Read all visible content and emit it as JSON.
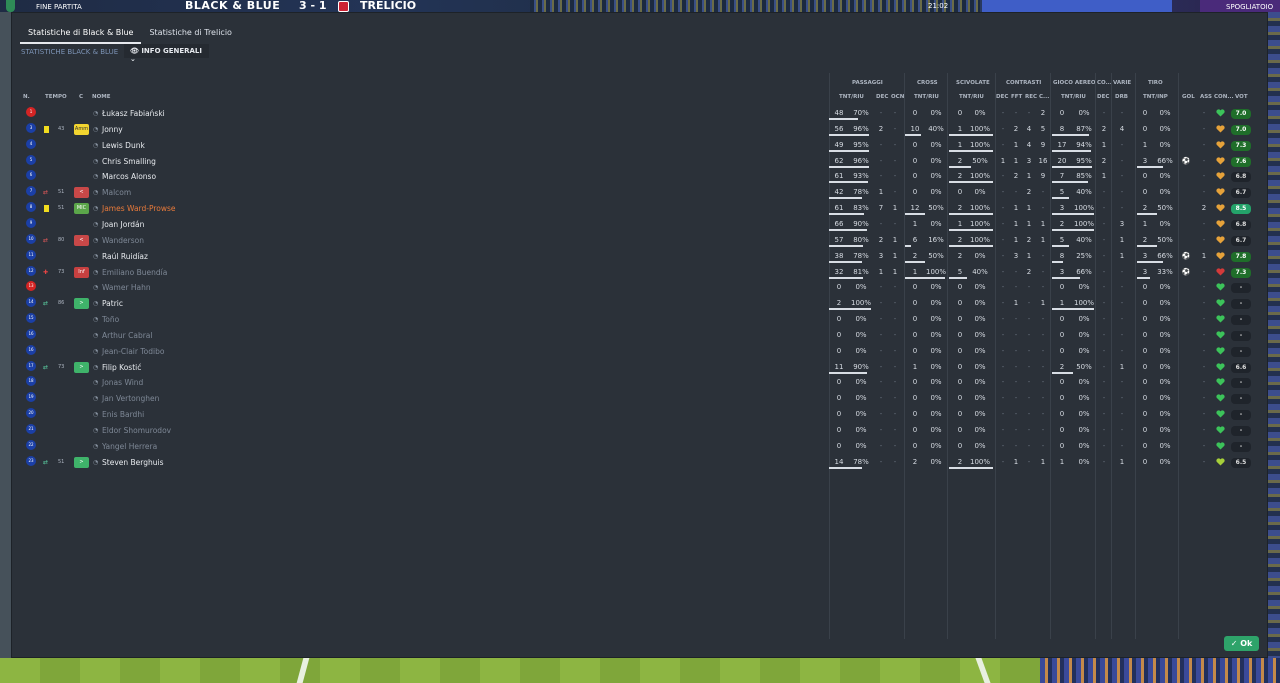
{
  "topbar": {
    "status": "FINE PARTITA",
    "home": "BLACK & BLUE",
    "score": "3 - 1",
    "away": "TRELICIO",
    "time": "21:02",
    "speaker": "SPOGLIATOIO"
  },
  "tabs": [
    {
      "label": "Statistiche di Black & Blue",
      "active": true
    },
    {
      "label": "Statistiche di Trelicio",
      "active": false
    }
  ],
  "subtitle": "STATISTICHE BLACK & BLUE",
  "dropdown": "INFO GENERALI",
  "groups": {
    "passaggi": "PASSAGGI",
    "cross": "CROSS",
    "scivolate": "SCIVOLATE",
    "contrasti": "CONTRASTI",
    "gioco_aereo": "GIOCO AEREO",
    "co": "CO...",
    "varie": "VARIE",
    "tiro": "TIRO"
  },
  "columns": {
    "n": "N.",
    "tempo": "TEMPO",
    "c": "C",
    "nome": "NOME",
    "pass_tnt": "TNT/RIU",
    "pass_dec": "DEC",
    "pass_ocn": "OCN",
    "cross_tnt": "TNT/RIU",
    "sciv_tnt": "TNT/RIU",
    "con_dec": "DEC",
    "con_fft": "FFT",
    "con_rec": "REC",
    "con_c": "C...",
    "aereo_tnt": "TNT/RIU",
    "co_dec": "DEC",
    "varie_drb": "DRB",
    "tiro_tnt": "TNT/INP",
    "gol": "GOL",
    "ass": "ASS",
    "con": "CON...",
    "vot": "VOT"
  },
  "players": [
    {
      "num": "1",
      "gk": true,
      "yellow": false,
      "ev": "",
      "min": "",
      "badge": "",
      "badge_text": "",
      "name": "Łukasz Fabiański",
      "dim": false,
      "or": false,
      "p_t": "48",
      "p_p": "70%",
      "p_dec": "-",
      "p_ocn": "-",
      "c_t": "0",
      "c_p": "0%",
      "s_t": "0",
      "s_p": "0%",
      "k_dec": "-",
      "k_fft": "-",
      "k_rec": "-",
      "k_c": "2",
      "a_t": "0",
      "a_p": "0%",
      "co": "-",
      "drb": "-",
      "t_t": "0",
      "t_p": "0%",
      "gol": "",
      "ass": "-",
      "heart": "green",
      "vot": "7.0",
      "vc": "r-green"
    },
    {
      "num": "3",
      "gk": false,
      "yellow": true,
      "ev": "",
      "min": "43",
      "badge": "b-amm",
      "badge_text": "Amm",
      "name": "Jonny",
      "dim": false,
      "or": false,
      "p_t": "56",
      "p_p": "96%",
      "p_dec": "2",
      "p_ocn": "-",
      "c_t": "10",
      "c_p": "40%",
      "s_t": "1",
      "s_p": "100%",
      "k_dec": "-",
      "k_fft": "2",
      "k_rec": "4",
      "k_c": "5",
      "a_t": "8",
      "a_p": "87%",
      "co": "2",
      "drb": "4",
      "t_t": "0",
      "t_p": "0%",
      "gol": "",
      "ass": "-",
      "heart": "orange",
      "vot": "7.0",
      "vc": "r-green"
    },
    {
      "num": "4",
      "gk": false,
      "yellow": false,
      "ev": "",
      "min": "",
      "badge": "",
      "badge_text": "",
      "name": "Lewis Dunk",
      "dim": false,
      "or": false,
      "p_t": "49",
      "p_p": "95%",
      "p_dec": "-",
      "p_ocn": "-",
      "c_t": "0",
      "c_p": "0%",
      "s_t": "1",
      "s_p": "100%",
      "k_dec": "-",
      "k_fft": "1",
      "k_rec": "4",
      "k_c": "9",
      "a_t": "17",
      "a_p": "94%",
      "co": "1",
      "drb": "-",
      "t_t": "1",
      "t_p": "0%",
      "gol": "",
      "ass": "-",
      "heart": "orange",
      "vot": "7.3",
      "vc": "r-green"
    },
    {
      "num": "5",
      "gk": false,
      "yellow": false,
      "ev": "",
      "min": "",
      "badge": "",
      "badge_text": "",
      "name": "Chris Smalling",
      "dim": false,
      "or": false,
      "p_t": "62",
      "p_p": "96%",
      "p_dec": "-",
      "p_ocn": "-",
      "c_t": "0",
      "c_p": "0%",
      "s_t": "2",
      "s_p": "50%",
      "k_dec": "1",
      "k_fft": "1",
      "k_rec": "3",
      "k_c": "16",
      "a_t": "20",
      "a_p": "95%",
      "co": "2",
      "drb": "-",
      "t_t": "3",
      "t_p": "66%",
      "gol": "⚽",
      "ass": "-",
      "heart": "orange",
      "vot": "7.6",
      "vc": "r-green"
    },
    {
      "num": "6",
      "gk": false,
      "yellow": false,
      "ev": "",
      "min": "",
      "badge": "",
      "badge_text": "",
      "name": "Marcos Alonso",
      "dim": false,
      "or": false,
      "p_t": "61",
      "p_p": "93%",
      "p_dec": "-",
      "p_ocn": "-",
      "c_t": "0",
      "c_p": "0%",
      "s_t": "2",
      "s_p": "100%",
      "k_dec": "-",
      "k_fft": "2",
      "k_rec": "1",
      "k_c": "9",
      "a_t": "7",
      "a_p": "85%",
      "co": "1",
      "drb": "-",
      "t_t": "0",
      "t_p": "0%",
      "gol": "",
      "ass": "-",
      "heart": "orange",
      "vot": "6.8",
      "vc": ""
    },
    {
      "num": "7",
      "gk": false,
      "yellow": false,
      "ev": "sub",
      "min": "51",
      "badge": "b-sub-out",
      "badge_text": "<",
      "name": "Malcom",
      "dim": true,
      "or": false,
      "p_t": "42",
      "p_p": "78%",
      "p_dec": "1",
      "p_ocn": "-",
      "c_t": "0",
      "c_p": "0%",
      "s_t": "0",
      "s_p": "0%",
      "k_dec": "-",
      "k_fft": "-",
      "k_rec": "2",
      "k_c": "-",
      "a_t": "5",
      "a_p": "40%",
      "co": "-",
      "drb": "-",
      "t_t": "0",
      "t_p": "0%",
      "gol": "",
      "ass": "-",
      "heart": "orange",
      "vot": "6.7",
      "vc": ""
    },
    {
      "num": "8",
      "gk": false,
      "yellow": true,
      "ev": "",
      "min": "51",
      "badge": "b-mic",
      "badge_text": "MIC",
      "name": "James Ward-Prowse",
      "dim": false,
      "or": true,
      "p_t": "61",
      "p_p": "83%",
      "p_dec": "7",
      "p_ocn": "1",
      "c_t": "12",
      "c_p": "50%",
      "s_t": "2",
      "s_p": "100%",
      "k_dec": "-",
      "k_fft": "1",
      "k_rec": "1",
      "k_c": "-",
      "a_t": "3",
      "a_p": "100%",
      "co": "-",
      "drb": "-",
      "t_t": "2",
      "t_p": "50%",
      "gol": "",
      "ass": "2",
      "heart": "orange",
      "vot": "8.5",
      "vc": "r-teal"
    },
    {
      "num": "9",
      "gk": false,
      "yellow": false,
      "ev": "",
      "min": "",
      "badge": "",
      "badge_text": "",
      "name": "Joan Jordán",
      "dim": false,
      "or": false,
      "p_t": "66",
      "p_p": "90%",
      "p_dec": "-",
      "p_ocn": "-",
      "c_t": "1",
      "c_p": "0%",
      "s_t": "1",
      "s_p": "100%",
      "k_dec": "-",
      "k_fft": "1",
      "k_rec": "1",
      "k_c": "1",
      "a_t": "2",
      "a_p": "100%",
      "co": "-",
      "drb": "3",
      "t_t": "1",
      "t_p": "0%",
      "gol": "",
      "ass": "-",
      "heart": "orange",
      "vot": "6.8",
      "vc": ""
    },
    {
      "num": "10",
      "gk": false,
      "yellow": false,
      "ev": "sub",
      "min": "80",
      "badge": "b-sub-out",
      "badge_text": "<",
      "name": "Wanderson",
      "dim": true,
      "or": false,
      "p_t": "57",
      "p_p": "80%",
      "p_dec": "2",
      "p_ocn": "1",
      "c_t": "6",
      "c_p": "16%",
      "s_t": "2",
      "s_p": "100%",
      "k_dec": "-",
      "k_fft": "1",
      "k_rec": "2",
      "k_c": "1",
      "a_t": "5",
      "a_p": "40%",
      "co": "-",
      "drb": "1",
      "t_t": "2",
      "t_p": "50%",
      "gol": "",
      "ass": "-",
      "heart": "orange",
      "vot": "6.7",
      "vc": ""
    },
    {
      "num": "11",
      "gk": false,
      "yellow": false,
      "ev": "",
      "min": "",
      "badge": "",
      "badge_text": "",
      "name": "Raúl Ruidíaz",
      "dim": false,
      "or": false,
      "p_t": "38",
      "p_p": "78%",
      "p_dec": "3",
      "p_ocn": "1",
      "c_t": "2",
      "c_p": "50%",
      "s_t": "2",
      "s_p": "0%",
      "k_dec": "-",
      "k_fft": "3",
      "k_rec": "1",
      "k_c": "-",
      "a_t": "8",
      "a_p": "25%",
      "co": "-",
      "drb": "1",
      "t_t": "3",
      "t_p": "66%",
      "gol": "⚽",
      "ass": "1",
      "heart": "orange",
      "vot": "7.8",
      "vc": "r-green"
    },
    {
      "num": "12",
      "gk": false,
      "yellow": false,
      "ev": "inj",
      "min": "73",
      "badge": "b-inf",
      "badge_text": "Inf",
      "name": "Emiliano Buendía",
      "dim": true,
      "or": false,
      "p_t": "32",
      "p_p": "81%",
      "p_dec": "1",
      "p_ocn": "1",
      "c_t": "1",
      "c_p": "100%",
      "s_t": "5",
      "s_p": "40%",
      "k_dec": "-",
      "k_fft": "-",
      "k_rec": "2",
      "k_c": "-",
      "a_t": "3",
      "a_p": "66%",
      "co": "-",
      "drb": "-",
      "t_t": "3",
      "t_p": "33%",
      "gol": "⚽",
      "ass": "-",
      "heart": "red",
      "vot": "7.3",
      "vc": "r-green"
    },
    {
      "num": "13",
      "gk": true,
      "yellow": false,
      "ev": "",
      "min": "",
      "badge": "",
      "badge_text": "",
      "name": "Wamer Hahn",
      "dim": true,
      "or": false,
      "p_t": "0",
      "p_p": "0%",
      "p_dec": "-",
      "p_ocn": "-",
      "c_t": "0",
      "c_p": "0%",
      "s_t": "0",
      "s_p": "0%",
      "k_dec": "-",
      "k_fft": "-",
      "k_rec": "-",
      "k_c": "-",
      "a_t": "0",
      "a_p": "0%",
      "co": "-",
      "drb": "-",
      "t_t": "0",
      "t_p": "0%",
      "gol": "",
      "ass": "-",
      "heart": "green",
      "vot": "-",
      "vc": ""
    },
    {
      "num": "14",
      "gk": false,
      "yellow": false,
      "ev": "subin",
      "min": "86",
      "badge": "b-sub-in",
      "badge_text": ">",
      "name": "Patric",
      "dim": false,
      "or": false,
      "p_t": "2",
      "p_p": "100%",
      "p_dec": "-",
      "p_ocn": "-",
      "c_t": "0",
      "c_p": "0%",
      "s_t": "0",
      "s_p": "0%",
      "k_dec": "-",
      "k_fft": "1",
      "k_rec": "-",
      "k_c": "1",
      "a_t": "1",
      "a_p": "100%",
      "co": "-",
      "drb": "-",
      "t_t": "0",
      "t_p": "0%",
      "gol": "",
      "ass": "-",
      "heart": "green",
      "vot": "-",
      "vc": ""
    },
    {
      "num": "15",
      "gk": false,
      "yellow": false,
      "ev": "",
      "min": "",
      "badge": "",
      "badge_text": "",
      "name": "Toño",
      "dim": true,
      "or": false,
      "p_t": "0",
      "p_p": "0%",
      "p_dec": "-",
      "p_ocn": "-",
      "c_t": "0",
      "c_p": "0%",
      "s_t": "0",
      "s_p": "0%",
      "k_dec": "-",
      "k_fft": "-",
      "k_rec": "-",
      "k_c": "-",
      "a_t": "0",
      "a_p": "0%",
      "co": "-",
      "drb": "-",
      "t_t": "0",
      "t_p": "0%",
      "gol": "",
      "ass": "-",
      "heart": "green",
      "vot": "-",
      "vc": ""
    },
    {
      "num": "16",
      "gk": false,
      "yellow": false,
      "ev": "",
      "min": "",
      "badge": "",
      "badge_text": "",
      "name": "Arthur Cabral",
      "dim": true,
      "or": false,
      "p_t": "0",
      "p_p": "0%",
      "p_dec": "-",
      "p_ocn": "-",
      "c_t": "0",
      "c_p": "0%",
      "s_t": "0",
      "s_p": "0%",
      "k_dec": "-",
      "k_fft": "-",
      "k_rec": "-",
      "k_c": "-",
      "a_t": "0",
      "a_p": "0%",
      "co": "-",
      "drb": "-",
      "t_t": "0",
      "t_p": "0%",
      "gol": "",
      "ass": "-",
      "heart": "green",
      "vot": "-",
      "vc": ""
    },
    {
      "num": "16",
      "gk": false,
      "yellow": false,
      "ev": "",
      "min": "",
      "badge": "",
      "badge_text": "",
      "name": "Jean-Clair Todibo",
      "dim": true,
      "or": false,
      "p_t": "0",
      "p_p": "0%",
      "p_dec": "-",
      "p_ocn": "-",
      "c_t": "0",
      "c_p": "0%",
      "s_t": "0",
      "s_p": "0%",
      "k_dec": "-",
      "k_fft": "-",
      "k_rec": "-",
      "k_c": "-",
      "a_t": "0",
      "a_p": "0%",
      "co": "-",
      "drb": "-",
      "t_t": "0",
      "t_p": "0%",
      "gol": "",
      "ass": "-",
      "heart": "green",
      "vot": "-",
      "vc": ""
    },
    {
      "num": "17",
      "gk": false,
      "yellow": false,
      "ev": "subin",
      "min": "73",
      "badge": "b-sub-in",
      "badge_text": ">",
      "name": "Filip Kostić",
      "dim": false,
      "or": false,
      "p_t": "11",
      "p_p": "90%",
      "p_dec": "-",
      "p_ocn": "-",
      "c_t": "1",
      "c_p": "0%",
      "s_t": "0",
      "s_p": "0%",
      "k_dec": "-",
      "k_fft": "-",
      "k_rec": "-",
      "k_c": "-",
      "a_t": "2",
      "a_p": "50%",
      "co": "-",
      "drb": "1",
      "t_t": "0",
      "t_p": "0%",
      "gol": "",
      "ass": "-",
      "heart": "green",
      "vot": "6.6",
      "vc": ""
    },
    {
      "num": "18",
      "gk": false,
      "yellow": false,
      "ev": "",
      "min": "",
      "badge": "",
      "badge_text": "",
      "name": "Jonas Wind",
      "dim": true,
      "or": false,
      "p_t": "0",
      "p_p": "0%",
      "p_dec": "-",
      "p_ocn": "-",
      "c_t": "0",
      "c_p": "0%",
      "s_t": "0",
      "s_p": "0%",
      "k_dec": "-",
      "k_fft": "-",
      "k_rec": "-",
      "k_c": "-",
      "a_t": "0",
      "a_p": "0%",
      "co": "-",
      "drb": "-",
      "t_t": "0",
      "t_p": "0%",
      "gol": "",
      "ass": "-",
      "heart": "green",
      "vot": "-",
      "vc": ""
    },
    {
      "num": "19",
      "gk": false,
      "yellow": false,
      "ev": "",
      "min": "",
      "badge": "",
      "badge_text": "",
      "name": "Jan Vertonghen",
      "dim": true,
      "or": false,
      "p_t": "0",
      "p_p": "0%",
      "p_dec": "-",
      "p_ocn": "-",
      "c_t": "0",
      "c_p": "0%",
      "s_t": "0",
      "s_p": "0%",
      "k_dec": "-",
      "k_fft": "-",
      "k_rec": "-",
      "k_c": "-",
      "a_t": "0",
      "a_p": "0%",
      "co": "-",
      "drb": "-",
      "t_t": "0",
      "t_p": "0%",
      "gol": "",
      "ass": "-",
      "heart": "green",
      "vot": "-",
      "vc": ""
    },
    {
      "num": "20",
      "gk": false,
      "yellow": false,
      "ev": "",
      "min": "",
      "badge": "",
      "badge_text": "",
      "name": "Enis Bardhi",
      "dim": true,
      "or": false,
      "p_t": "0",
      "p_p": "0%",
      "p_dec": "-",
      "p_ocn": "-",
      "c_t": "0",
      "c_p": "0%",
      "s_t": "0",
      "s_p": "0%",
      "k_dec": "-",
      "k_fft": "-",
      "k_rec": "-",
      "k_c": "-",
      "a_t": "0",
      "a_p": "0%",
      "co": "-",
      "drb": "-",
      "t_t": "0",
      "t_p": "0%",
      "gol": "",
      "ass": "-",
      "heart": "green",
      "vot": "-",
      "vc": ""
    },
    {
      "num": "21",
      "gk": false,
      "yellow": false,
      "ev": "",
      "min": "",
      "badge": "",
      "badge_text": "",
      "name": "Eldor Shomurodov",
      "dim": true,
      "or": false,
      "p_t": "0",
      "p_p": "0%",
      "p_dec": "-",
      "p_ocn": "-",
      "c_t": "0",
      "c_p": "0%",
      "s_t": "0",
      "s_p": "0%",
      "k_dec": "-",
      "k_fft": "-",
      "k_rec": "-",
      "k_c": "-",
      "a_t": "0",
      "a_p": "0%",
      "co": "-",
      "drb": "-",
      "t_t": "0",
      "t_p": "0%",
      "gol": "",
      "ass": "-",
      "heart": "green",
      "vot": "-",
      "vc": ""
    },
    {
      "num": "22",
      "gk": false,
      "yellow": false,
      "ev": "",
      "min": "",
      "badge": "",
      "badge_text": "",
      "name": "Yangel Herrera",
      "dim": true,
      "or": false,
      "p_t": "0",
      "p_p": "0%",
      "p_dec": "-",
      "p_ocn": "-",
      "c_t": "0",
      "c_p": "0%",
      "s_t": "0",
      "s_p": "0%",
      "k_dec": "-",
      "k_fft": "-",
      "k_rec": "-",
      "k_c": "-",
      "a_t": "0",
      "a_p": "0%",
      "co": "-",
      "drb": "-",
      "t_t": "0",
      "t_p": "0%",
      "gol": "",
      "ass": "-",
      "heart": "green",
      "vot": "-",
      "vc": ""
    },
    {
      "num": "23",
      "gk": false,
      "yellow": false,
      "ev": "subin",
      "min": "51",
      "badge": "b-sub-in",
      "badge_text": ">",
      "name": "Steven Berghuis",
      "dim": false,
      "or": false,
      "p_t": "14",
      "p_p": "78%",
      "p_dec": "-",
      "p_ocn": "-",
      "c_t": "2",
      "c_p": "0%",
      "s_t": "2",
      "s_p": "100%",
      "k_dec": "-",
      "k_fft": "1",
      "k_rec": "-",
      "k_c": "1",
      "a_t": "1",
      "a_p": "0%",
      "co": "-",
      "drb": "1",
      "t_t": "0",
      "t_p": "0%",
      "gol": "",
      "ass": "-",
      "heart": "lime",
      "vot": "6.5",
      "vc": ""
    }
  ],
  "ok_label": "Ok"
}
